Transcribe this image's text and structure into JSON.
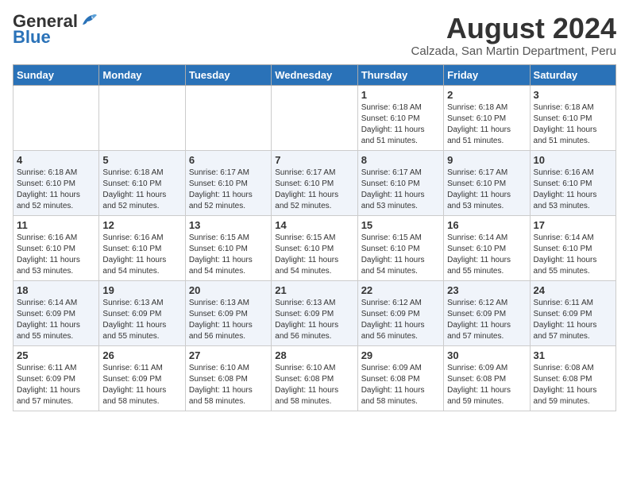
{
  "header": {
    "logo_general": "General",
    "logo_blue": "Blue",
    "title": "August 2024",
    "subtitle": "Calzada, San Martin Department, Peru"
  },
  "days_of_week": [
    "Sunday",
    "Monday",
    "Tuesday",
    "Wednesday",
    "Thursday",
    "Friday",
    "Saturday"
  ],
  "weeks": [
    [
      {
        "num": "",
        "info": ""
      },
      {
        "num": "",
        "info": ""
      },
      {
        "num": "",
        "info": ""
      },
      {
        "num": "",
        "info": ""
      },
      {
        "num": "1",
        "info": "Sunrise: 6:18 AM\nSunset: 6:10 PM\nDaylight: 11 hours\nand 51 minutes."
      },
      {
        "num": "2",
        "info": "Sunrise: 6:18 AM\nSunset: 6:10 PM\nDaylight: 11 hours\nand 51 minutes."
      },
      {
        "num": "3",
        "info": "Sunrise: 6:18 AM\nSunset: 6:10 PM\nDaylight: 11 hours\nand 51 minutes."
      }
    ],
    [
      {
        "num": "4",
        "info": "Sunrise: 6:18 AM\nSunset: 6:10 PM\nDaylight: 11 hours\nand 52 minutes."
      },
      {
        "num": "5",
        "info": "Sunrise: 6:18 AM\nSunset: 6:10 PM\nDaylight: 11 hours\nand 52 minutes."
      },
      {
        "num": "6",
        "info": "Sunrise: 6:17 AM\nSunset: 6:10 PM\nDaylight: 11 hours\nand 52 minutes."
      },
      {
        "num": "7",
        "info": "Sunrise: 6:17 AM\nSunset: 6:10 PM\nDaylight: 11 hours\nand 52 minutes."
      },
      {
        "num": "8",
        "info": "Sunrise: 6:17 AM\nSunset: 6:10 PM\nDaylight: 11 hours\nand 53 minutes."
      },
      {
        "num": "9",
        "info": "Sunrise: 6:17 AM\nSunset: 6:10 PM\nDaylight: 11 hours\nand 53 minutes."
      },
      {
        "num": "10",
        "info": "Sunrise: 6:16 AM\nSunset: 6:10 PM\nDaylight: 11 hours\nand 53 minutes."
      }
    ],
    [
      {
        "num": "11",
        "info": "Sunrise: 6:16 AM\nSunset: 6:10 PM\nDaylight: 11 hours\nand 53 minutes."
      },
      {
        "num": "12",
        "info": "Sunrise: 6:16 AM\nSunset: 6:10 PM\nDaylight: 11 hours\nand 54 minutes."
      },
      {
        "num": "13",
        "info": "Sunrise: 6:15 AM\nSunset: 6:10 PM\nDaylight: 11 hours\nand 54 minutes."
      },
      {
        "num": "14",
        "info": "Sunrise: 6:15 AM\nSunset: 6:10 PM\nDaylight: 11 hours\nand 54 minutes."
      },
      {
        "num": "15",
        "info": "Sunrise: 6:15 AM\nSunset: 6:10 PM\nDaylight: 11 hours\nand 54 minutes."
      },
      {
        "num": "16",
        "info": "Sunrise: 6:14 AM\nSunset: 6:10 PM\nDaylight: 11 hours\nand 55 minutes."
      },
      {
        "num": "17",
        "info": "Sunrise: 6:14 AM\nSunset: 6:10 PM\nDaylight: 11 hours\nand 55 minutes."
      }
    ],
    [
      {
        "num": "18",
        "info": "Sunrise: 6:14 AM\nSunset: 6:09 PM\nDaylight: 11 hours\nand 55 minutes."
      },
      {
        "num": "19",
        "info": "Sunrise: 6:13 AM\nSunset: 6:09 PM\nDaylight: 11 hours\nand 55 minutes."
      },
      {
        "num": "20",
        "info": "Sunrise: 6:13 AM\nSunset: 6:09 PM\nDaylight: 11 hours\nand 56 minutes."
      },
      {
        "num": "21",
        "info": "Sunrise: 6:13 AM\nSunset: 6:09 PM\nDaylight: 11 hours\nand 56 minutes."
      },
      {
        "num": "22",
        "info": "Sunrise: 6:12 AM\nSunset: 6:09 PM\nDaylight: 11 hours\nand 56 minutes."
      },
      {
        "num": "23",
        "info": "Sunrise: 6:12 AM\nSunset: 6:09 PM\nDaylight: 11 hours\nand 57 minutes."
      },
      {
        "num": "24",
        "info": "Sunrise: 6:11 AM\nSunset: 6:09 PM\nDaylight: 11 hours\nand 57 minutes."
      }
    ],
    [
      {
        "num": "25",
        "info": "Sunrise: 6:11 AM\nSunset: 6:09 PM\nDaylight: 11 hours\nand 57 minutes."
      },
      {
        "num": "26",
        "info": "Sunrise: 6:11 AM\nSunset: 6:09 PM\nDaylight: 11 hours\nand 58 minutes."
      },
      {
        "num": "27",
        "info": "Sunrise: 6:10 AM\nSunset: 6:08 PM\nDaylight: 11 hours\nand 58 minutes."
      },
      {
        "num": "28",
        "info": "Sunrise: 6:10 AM\nSunset: 6:08 PM\nDaylight: 11 hours\nand 58 minutes."
      },
      {
        "num": "29",
        "info": "Sunrise: 6:09 AM\nSunset: 6:08 PM\nDaylight: 11 hours\nand 58 minutes."
      },
      {
        "num": "30",
        "info": "Sunrise: 6:09 AM\nSunset: 6:08 PM\nDaylight: 11 hours\nand 59 minutes."
      },
      {
        "num": "31",
        "info": "Sunrise: 6:08 AM\nSunset: 6:08 PM\nDaylight: 11 hours\nand 59 minutes."
      }
    ]
  ]
}
